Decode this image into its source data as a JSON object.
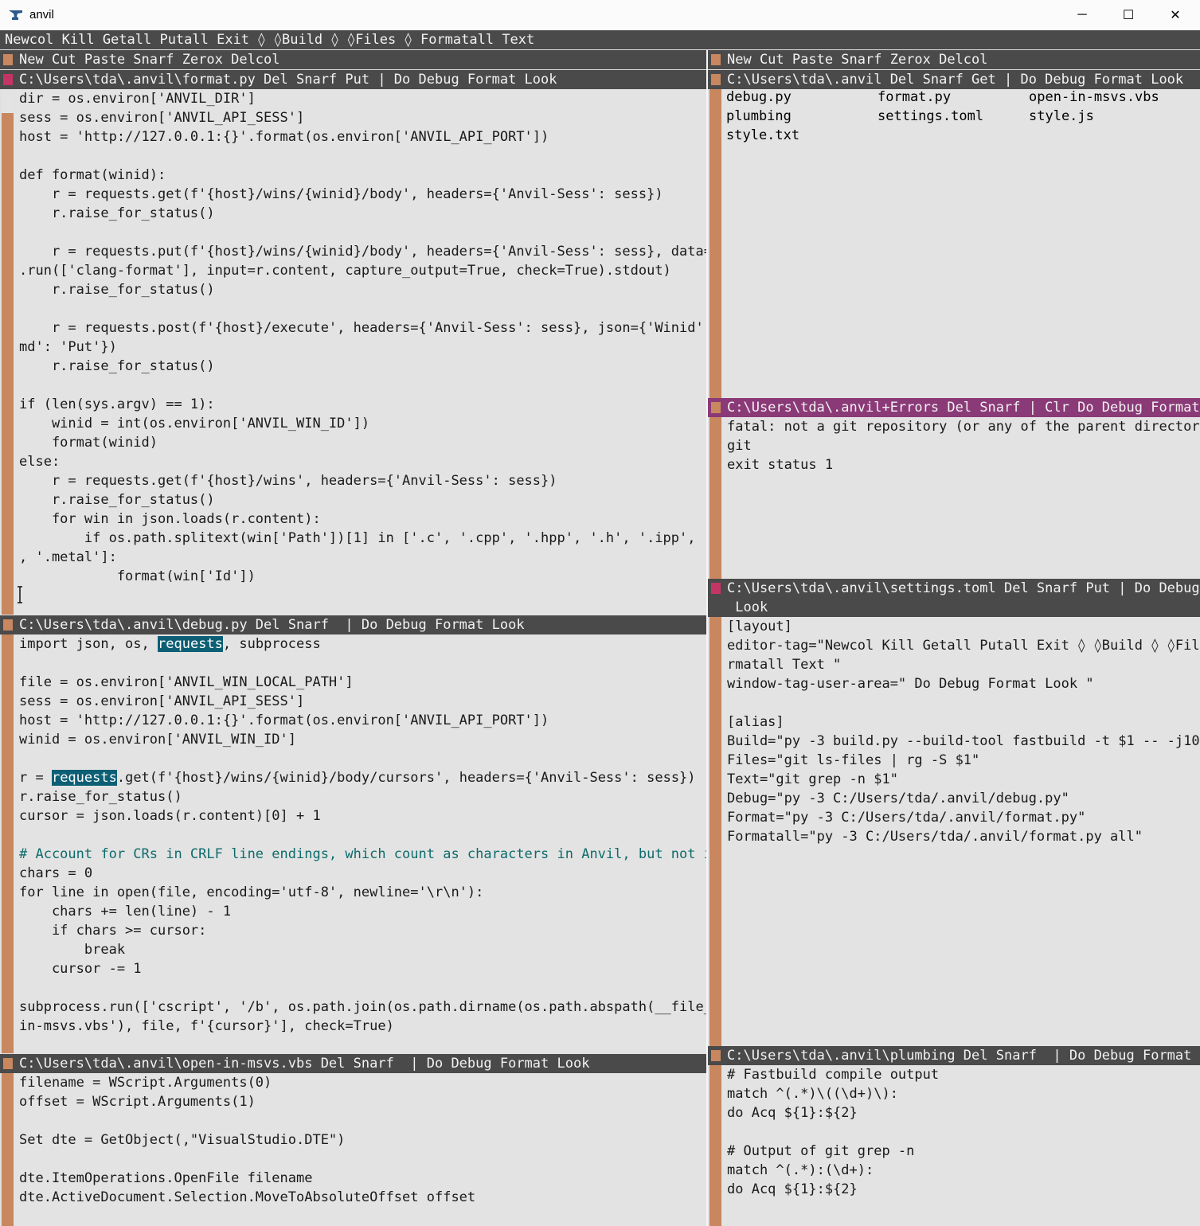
{
  "window": {
    "title": "anvil",
    "controls": {
      "minimize": "─",
      "maximize": "☐",
      "close": "✕"
    }
  },
  "editor_tag": "Newcol Kill Getall Putall Exit ◊ ◊Build ◊ ◊Files ◊ Formatall Text",
  "columns": [
    {
      "tag": "New Cut Paste Snarf Zerox Delcol"
    },
    {
      "tag": "New Cut Paste Snarf Zerox Delcol"
    }
  ],
  "windows": {
    "format_py": {
      "tag": "C:\\Users\\tda\\.anvil\\format.py Del Snarf Put | Do Debug Format Look",
      "lines": [
        "dir = os.environ['ANVIL_DIR']",
        "sess = os.environ['ANVIL_API_SESS']",
        "host = 'http://127.0.0.1:{}'.format(os.environ['ANVIL_API_PORT'])",
        "",
        "def format(winid):",
        "    r = requests.get(f'{host}/wins/{winid}/body', headers={'Anvil-Sess': sess})",
        "    r.raise_for_status()",
        "",
        "    r = requests.put(f'{host}/wins/{winid}/body', headers={'Anvil-Sess': sess}, data=subprocess",
        ".run(['clang-format'], input=r.content, capture_output=True, check=True).stdout)",
        "    r.raise_for_status()",
        "",
        "    r = requests.post(f'{host}/execute', headers={'Anvil-Sess': sess}, json={'Winid': winid, 'C",
        "md': 'Put'})",
        "    r.raise_for_status()",
        "",
        "if (len(sys.argv) == 1):",
        "    winid = int(os.environ['ANVIL_WIN_ID'])",
        "    format(winid)",
        "else:",
        "    r = requests.get(f'{host}/wins', headers={'Anvil-Sess': sess})",
        "    r.raise_for_status()",
        "    for win in json.loads(r.content):",
        "        if os.path.splitext(win['Path'])[1] in ['.c', '.cpp', '.hpp', '.h', '.ipp', '.m', '.mm'",
        ", '.metal']:",
        "            format(win['Id'])"
      ]
    },
    "debug_py": {
      "tag": "C:\\Users\\tda\\.anvil\\debug.py Del Snarf  | Do Debug Format Look",
      "line1_pre": "import json, os, ",
      "line1_hl": "requests",
      "line1_post": ", subprocess",
      "lines_a": [
        "",
        "file = os.environ['ANVIL_WIN_LOCAL_PATH']",
        "sess = os.environ['ANVIL_API_SESS']",
        "host = 'http://127.0.0.1:{}'.format(os.environ['ANVIL_API_PORT'])",
        "winid = os.environ['ANVIL_WIN_ID']",
        ""
      ],
      "line8_pre": "r = ",
      "line8_hl": "requests",
      "line8_post": ".get(f'{host}/wins/{winid}/body/cursors', headers={'Anvil-Sess': sess})",
      "lines_b": [
        "r.raise_for_status()",
        "cursor = json.loads(r.content)[0] + 1",
        ""
      ],
      "comment": "# Account for CRs in CRLF line endings, which count as characters in Anvil, but not in MSVS",
      "lines_c": [
        "chars = 0",
        "for line in open(file, encoding='utf-8', newline='\\r\\n'):",
        "    chars += len(line) - 1",
        "    if chars >= cursor:",
        "        break",
        "    cursor -= 1",
        "",
        "subprocess.run(['cscript', '/b', os.path.join(os.path.dirname(os.path.abspath(__file__)), 'open-",
        "in-msvs.vbs'), file, f'{cursor}'], check=True)"
      ]
    },
    "open_in_msvs": {
      "tag": "C:\\Users\\tda\\.anvil\\open-in-msvs.vbs Del Snarf  | Do Debug Format Look",
      "lines": [
        "filename = WScript.Arguments(0)",
        "offset = WScript.Arguments(1)",
        "",
        "Set dte = GetObject(,\"VisualStudio.DTE\")",
        "",
        "dte.ItemOperations.OpenFile filename",
        "dte.ActiveDocument.Selection.MoveToAbsoluteOffset offset"
      ]
    },
    "dir_listing": {
      "tag": "C:\\Users\\tda\\.anvil Del Snarf Get | Do Debug Format Look",
      "files": [
        "debug.py",
        "format.py",
        "open-in-msvs.vbs",
        "plumbing",
        "settings.toml",
        "style.js",
        "style.txt"
      ]
    },
    "errors": {
      "tag": "C:\\Users\\tda\\.anvil+Errors Del Snarf | Clr Do Debug Format Look",
      "lines": [
        "fatal: not a git repository (or any of the parent directories): .",
        "git",
        "exit status 1"
      ]
    },
    "settings_toml": {
      "tag_line1": "C:\\Users\\tda\\.anvil\\settings.toml Del Snarf Put | Do Debug Format",
      "tag_line2": " Look",
      "lines": [
        "[layout]",
        "editor-tag=\"Newcol Kill Getall Putall Exit ◊ ◊Build ◊ ◊Files ◊ Fo",
        "rmatall Text \"",
        "window-tag-user-area=\" Do Debug Format Look \"",
        "",
        "[alias]",
        "Build=\"py -3 build.py --build-tool fastbuild -t $1 -- -j10\"",
        "Files=\"git ls-files | rg -S $1\"",
        "Text=\"git grep -n $1\"",
        "Debug=\"py -3 C:/Users/tda/.anvil/debug.py\"",
        "Format=\"py -3 C:/Users/tda/.anvil/format.py\"",
        "Formatall=\"py -3 C:/Users/tda/.anvil/format.py all\""
      ]
    },
    "plumbing": {
      "tag": "C:\\Users\\tda\\.anvil\\plumbing Del Snarf  | Do Debug Format Look",
      "lines": [
        "# Fastbuild compile output",
        "match ^(.*)\\((\\d+)\\):",
        "do Acq ${1}:${2}",
        "",
        "# Output of git grep -n",
        "match ^(.*):(\\d+):",
        "do Acq ${1}:${2}"
      ]
    }
  },
  "colors": {
    "tag_bg": "#4a4a4a",
    "error_tag_bg": "#8b3a78",
    "scrollbar": "#c8875f",
    "dirty_box": "#c43565",
    "selection": "#0d5f75",
    "comment": "#0f6b6b",
    "body_bg": "#e3e3e3"
  }
}
